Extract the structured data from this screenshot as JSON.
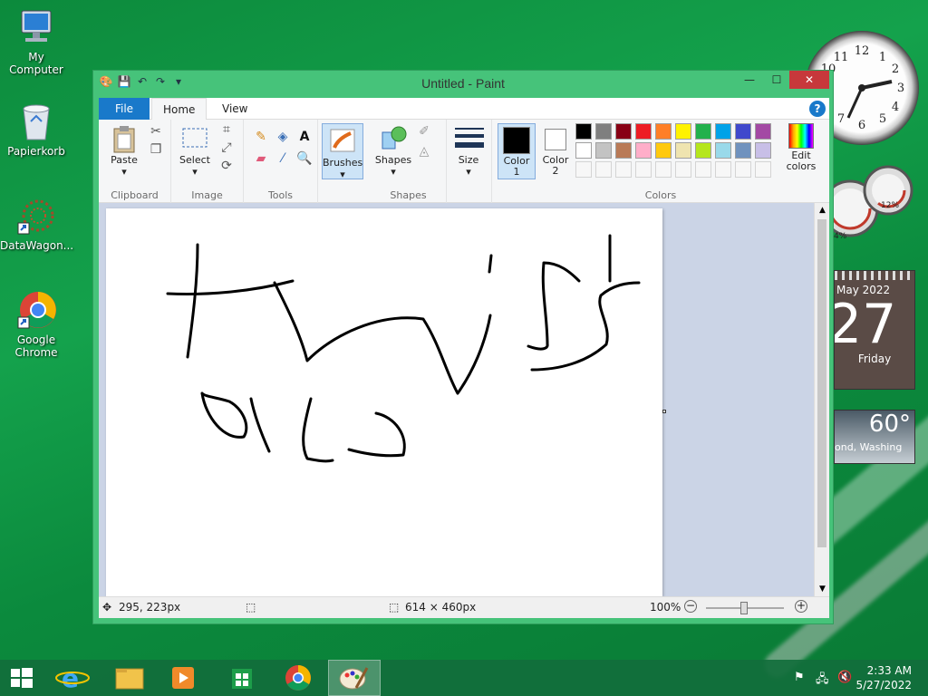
{
  "desktop": {
    "icons": [
      {
        "label": "My Computer",
        "icon": "computer-icon"
      },
      {
        "label": "Papierkorb",
        "icon": "recycle-bin-icon"
      },
      {
        "label": "DataWagon...",
        "icon": "datawagon-icon"
      },
      {
        "label": "Google Chrome",
        "icon": "chrome-icon"
      }
    ]
  },
  "window": {
    "title": "Untitled - Paint",
    "tabs": {
      "file": "File",
      "home": "Home",
      "view": "View"
    },
    "help": "?"
  },
  "ribbon": {
    "clipboard": {
      "label": "Clipboard",
      "paste": "Paste"
    },
    "image": {
      "label": "Image",
      "select": "Select"
    },
    "tools": {
      "label": "Tools"
    },
    "brushes": {
      "label": "Brushes"
    },
    "shapes": {
      "label": "Shapes",
      "button": "Shapes"
    },
    "size": {
      "label": "Size"
    },
    "colors": {
      "label": "Colors",
      "color1": "Color\n1",
      "color2": "Color\n2",
      "edit": "Edit colors",
      "color1_value": "#000000",
      "color2_value": "#ffffff",
      "palette_row1": [
        "#000000",
        "#7f7f7f",
        "#880015",
        "#ed1c24",
        "#ff7f27",
        "#fff200",
        "#22b14c",
        "#00a2e8",
        "#3f48cc",
        "#a349a4"
      ],
      "palette_row2": [
        "#ffffff",
        "#c3c3c3",
        "#b97a57",
        "#ffaec9",
        "#ffc90e",
        "#efe4b0",
        "#b5e61d",
        "#99d9ea",
        "#7092be",
        "#c8bfe7"
      ]
    }
  },
  "status": {
    "cursor": "295, 223px",
    "size": "614 × 460px",
    "zoom": "100%"
  },
  "gadgets": {
    "calendar_month": "May 2022",
    "calendar_day": "27",
    "calendar_weekday": "Friday",
    "weather_temp": "60°",
    "weather_place": "ond, Washing",
    "cpu_percent": "12%",
    "mem_percent": "4%"
  },
  "tray": {
    "time": "2:33 AM",
    "date": "5/27/2022"
  }
}
